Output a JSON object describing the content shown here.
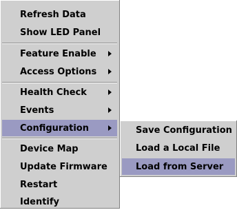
{
  "menu": {
    "items": [
      {
        "label": "Refresh Data"
      },
      {
        "label": "Show LED Panel"
      },
      {
        "label": "Feature Enable"
      },
      {
        "label": "Access Options"
      },
      {
        "label": "Health Check"
      },
      {
        "label": "Events"
      },
      {
        "label": "Configuration"
      },
      {
        "label": "Device Map"
      },
      {
        "label": "Update Firmware"
      },
      {
        "label": "Restart"
      },
      {
        "label": "Identify"
      }
    ]
  },
  "submenu": {
    "items": [
      {
        "label": "Save Configuration"
      },
      {
        "label": "Load a Local File"
      },
      {
        "label": "Load from Server"
      }
    ]
  },
  "colors": {
    "menu_bg": "#cfcfcf",
    "highlight": "#9a9ac2",
    "text": "#000000"
  },
  "icons": {
    "submenu_arrow": "right-triangle-arrow"
  }
}
